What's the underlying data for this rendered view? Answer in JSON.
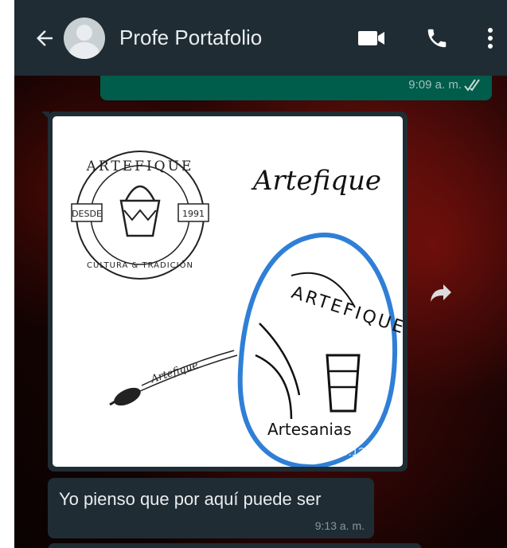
{
  "header": {
    "contact_name": "Profe Portafolio",
    "back_icon": "arrow-left-icon",
    "avatar_icon": "default-avatar-icon",
    "video_icon": "videocam-icon",
    "call_icon": "phone-icon",
    "menu_icon": "more-vert-icon"
  },
  "messages": [
    {
      "direction": "outgoing",
      "time": "9:09 a. m.",
      "status": "read"
    },
    {
      "direction": "incoming",
      "type": "image",
      "time": "9:13 a. m.",
      "image_text": {
        "seal_top": "ARTEFIQUE",
        "seal_left": "DESDE",
        "seal_right": "1991",
        "seal_bottom": "CULTURA & TRADICIÓN",
        "script_logo": "Artefique",
        "brush_text": "Artefique",
        "circled_logo_top": "ARTEFIQUE",
        "circled_logo_bottom": "Artesanias"
      }
    },
    {
      "direction": "incoming",
      "type": "text",
      "text": "Yo pienso que por aquí puede ser",
      "time": "9:13 a. m."
    }
  ],
  "colors": {
    "header_bg": "#1f2c34",
    "incoming_bubble": "#1f2c34",
    "outgoing_bubble": "#005c4b",
    "read_ticks": "#53bdeb",
    "highlight_circle": "#2f7fd6"
  }
}
